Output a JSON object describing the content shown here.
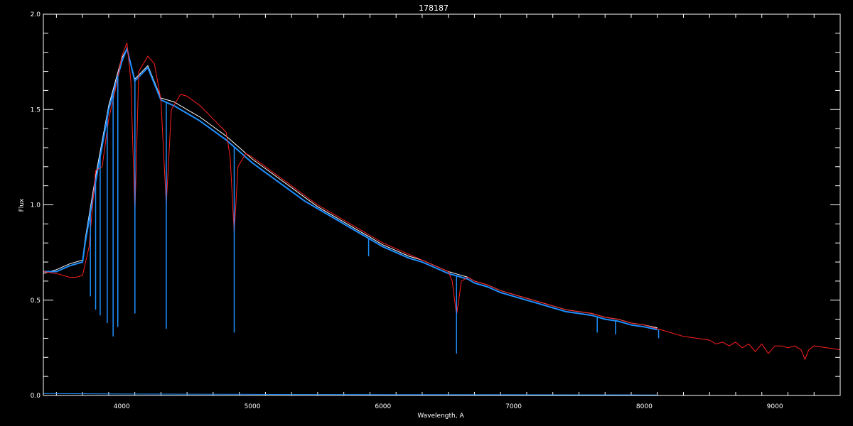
{
  "chart_data": {
    "type": "line",
    "title": "178187",
    "xlabel": "Wavelength, A",
    "ylabel": "Flux",
    "xlim": [
      3400,
      9500
    ],
    "ylim": [
      0.0,
      2.0
    ],
    "xticks": [
      4000,
      5000,
      6000,
      7000,
      8000,
      9000
    ],
    "xtick_labels": [
      "4000",
      "5000",
      "6000",
      "7000",
      "8000",
      "9000"
    ],
    "yticks": [
      0.0,
      0.5,
      1.0,
      1.5,
      2.0
    ],
    "ytick_labels": [
      "0.0",
      "0.5",
      "1.0",
      "1.5",
      "2.0"
    ],
    "grid": false,
    "background": "#000000",
    "series": [
      {
        "color": "#ffffff",
        "x": [
          3400,
          3500,
          3600,
          3700,
          3720,
          3800,
          3900,
          4000,
          4040,
          4100,
          4200,
          4300,
          4400,
          4500,
          4600,
          4700,
          4800,
          4900,
          4950,
          5000,
          5100,
          5200,
          5300,
          5400,
          5500,
          5600,
          5700,
          5800,
          5900,
          6000,
          6100,
          6200,
          6300,
          6400,
          6500,
          6550,
          6600,
          6650,
          6700,
          6800,
          6900,
          7000,
          7100,
          7200,
          7300,
          7400,
          7500,
          7600,
          7700,
          7800,
          7900,
          8000,
          8100
        ],
        "y": [
          0.64,
          0.66,
          0.69,
          0.71,
          0.82,
          1.15,
          1.52,
          1.77,
          1.82,
          1.66,
          1.73,
          1.56,
          1.54,
          1.5,
          1.46,
          1.41,
          1.36,
          1.3,
          1.27,
          1.24,
          1.19,
          1.14,
          1.09,
          1.04,
          0.99,
          0.95,
          0.91,
          0.87,
          0.83,
          0.79,
          0.76,
          0.73,
          0.71,
          0.68,
          0.65,
          0.64,
          0.63,
          0.62,
          0.6,
          0.58,
          0.55,
          0.53,
          0.51,
          0.49,
          0.47,
          0.45,
          0.44,
          0.43,
          0.41,
          0.4,
          0.38,
          0.37,
          0.355
        ]
      },
      {
        "color": "#1e90ff",
        "x": [
          3400,
          3500,
          3600,
          3700,
          3720,
          3800,
          3900,
          4000,
          4040,
          4100,
          4200,
          4300,
          4400,
          4500,
          4600,
          4700,
          4800,
          4900,
          4950,
          5000,
          5100,
          5200,
          5300,
          5400,
          5500,
          5600,
          5700,
          5800,
          5900,
          6000,
          6100,
          6200,
          6300,
          6400,
          6500,
          6550,
          6600,
          6650,
          6700,
          6800,
          6900,
          7000,
          7100,
          7200,
          7300,
          7400,
          7500,
          7600,
          7700,
          7800,
          7900,
          8000,
          8100
        ],
        "y": [
          0.65,
          0.65,
          0.68,
          0.7,
          0.8,
          1.12,
          1.5,
          1.75,
          1.82,
          1.65,
          1.72,
          1.55,
          1.52,
          1.48,
          1.44,
          1.39,
          1.34,
          1.28,
          1.25,
          1.22,
          1.17,
          1.12,
          1.07,
          1.02,
          0.98,
          0.94,
          0.9,
          0.86,
          0.82,
          0.78,
          0.75,
          0.72,
          0.7,
          0.67,
          0.64,
          0.63,
          0.62,
          0.61,
          0.59,
          0.57,
          0.54,
          0.52,
          0.5,
          0.48,
          0.46,
          0.44,
          0.43,
          0.42,
          0.4,
          0.39,
          0.37,
          0.36,
          0.345
        ]
      },
      {
        "color": "#ff2020",
        "x": [
          3400,
          3500,
          3600,
          3650,
          3700,
          3750,
          3800,
          3850,
          3900,
          3950,
          4000,
          4040,
          4070,
          4101,
          4130,
          4200,
          4250,
          4300,
          4341,
          4380,
          4450,
          4500,
          4600,
          4700,
          4800,
          4830,
          4861,
          4890,
          4950,
          5000,
          5100,
          5200,
          5300,
          5400,
          5500,
          5600,
          5700,
          5800,
          5900,
          6000,
          6100,
          6200,
          6300,
          6400,
          6500,
          6530,
          6563,
          6600,
          6650,
          6700,
          6800,
          6900,
          7000,
          7100,
          7200,
          7300,
          7400,
          7500,
          7600,
          7700,
          7800,
          7900,
          8000,
          8100,
          8200,
          8300,
          8400,
          8500,
          8550,
          8600,
          8650,
          8700,
          8750,
          8800,
          8850,
          8900,
          8950,
          9000,
          9050,
          9100,
          9150,
          9200,
          9230,
          9260,
          9300,
          9400,
          9500
        ],
        "y": [
          0.65,
          0.64,
          0.62,
          0.62,
          0.63,
          0.78,
          1.18,
          1.2,
          1.45,
          1.6,
          1.78,
          1.85,
          1.65,
          0.95,
          1.7,
          1.78,
          1.74,
          1.55,
          1.0,
          1.5,
          1.58,
          1.57,
          1.52,
          1.45,
          1.38,
          1.25,
          0.85,
          1.2,
          1.27,
          1.25,
          1.2,
          1.15,
          1.1,
          1.05,
          1.0,
          0.96,
          0.92,
          0.88,
          0.84,
          0.8,
          0.77,
          0.74,
          0.71,
          0.68,
          0.65,
          0.6,
          0.42,
          0.6,
          0.62,
          0.6,
          0.58,
          0.55,
          0.53,
          0.51,
          0.49,
          0.47,
          0.45,
          0.44,
          0.43,
          0.41,
          0.4,
          0.38,
          0.37,
          0.35,
          0.33,
          0.31,
          0.3,
          0.29,
          0.27,
          0.28,
          0.26,
          0.28,
          0.25,
          0.27,
          0.23,
          0.27,
          0.22,
          0.26,
          0.26,
          0.25,
          0.26,
          0.24,
          0.19,
          0.24,
          0.26,
          0.25,
          0.24
        ]
      },
      {
        "color": "#1e90ff",
        "x": [
          3400,
          4000,
          5000,
          6000,
          7000,
          8000,
          8100
        ],
        "y": [
          0.01,
          0.008,
          0.006,
          0.005,
          0.004,
          0.003,
          0.003
        ]
      }
    ],
    "absorption_lines": [
      {
        "x": 3760,
        "y": 0.52
      },
      {
        "x": 3800,
        "y": 0.45
      },
      {
        "x": 3835,
        "y": 0.42
      },
      {
        "x": 3889,
        "y": 0.38
      },
      {
        "x": 3934,
        "y": 0.31
      },
      {
        "x": 3970,
        "y": 0.36
      },
      {
        "x": 4101,
        "y": 0.43
      },
      {
        "x": 4341,
        "y": 0.35
      },
      {
        "x": 4861,
        "y": 0.33
      },
      {
        "x": 5890,
        "y": 0.73
      },
      {
        "x": 6563,
        "y": 0.22
      },
      {
        "x": 7640,
        "y": 0.33
      },
      {
        "x": 7780,
        "y": 0.32
      },
      {
        "x": 8110,
        "y": 0.3
      }
    ]
  }
}
